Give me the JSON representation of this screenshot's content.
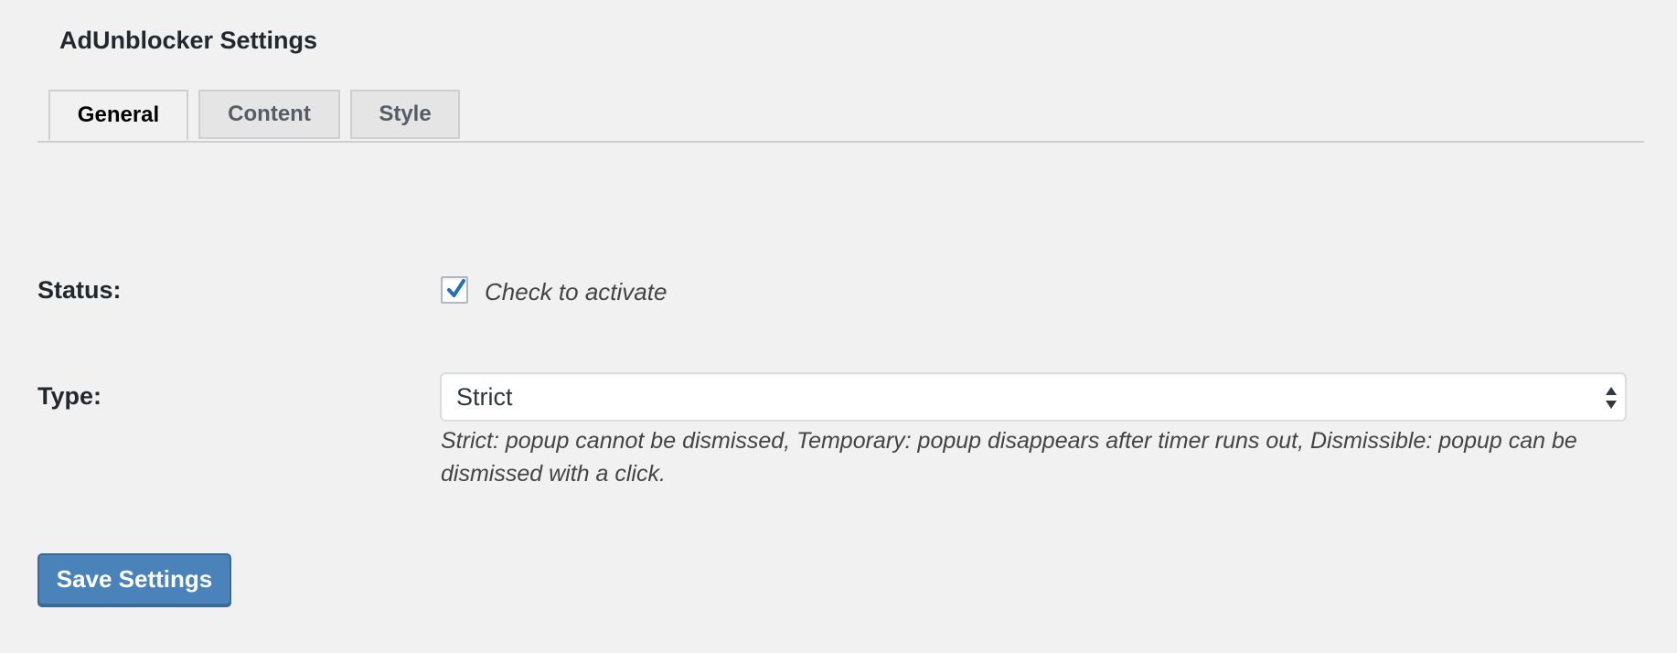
{
  "page": {
    "title": "AdUnblocker Settings"
  },
  "tabs": [
    {
      "label": "General",
      "active": true
    },
    {
      "label": "Content",
      "active": false
    },
    {
      "label": "Style",
      "active": false
    }
  ],
  "fields": {
    "status": {
      "label": "Status:",
      "checkbox_checked": true,
      "checkbox_label": "Check to activate"
    },
    "type": {
      "label": "Type:",
      "selected": "Strict",
      "description": "Strict: popup cannot be dismissed, Temporary: popup disappears after timer runs out, Dismissible: popup can be dismissed with a click."
    }
  },
  "actions": {
    "save_label": "Save Settings"
  },
  "colors": {
    "background": "#f1f1f1",
    "accent": "#4a83ba",
    "check": "#2271b1"
  },
  "icons": {
    "checkmark": "checkmark-icon",
    "select_arrows": "updown-arrows-icon"
  }
}
